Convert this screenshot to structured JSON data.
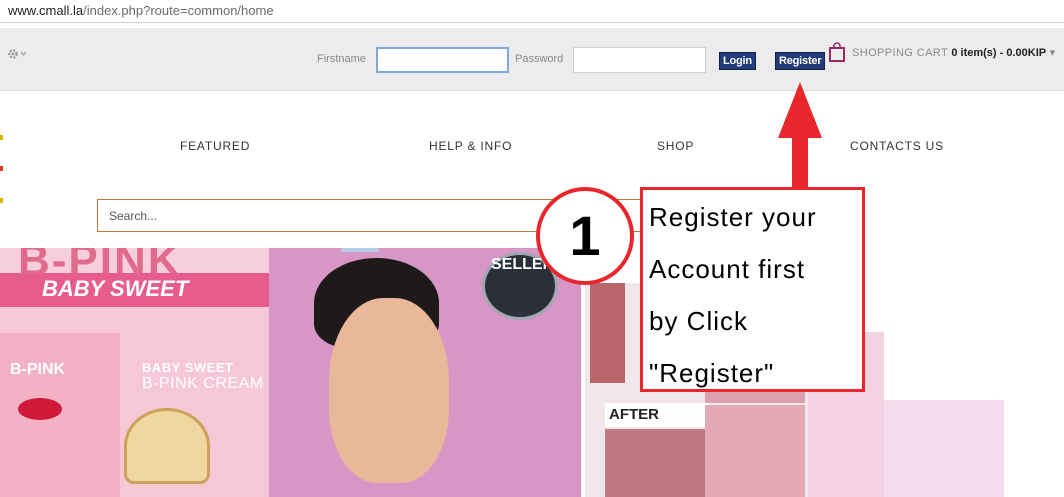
{
  "browser": {
    "url_host": "www.cmall.la",
    "url_path": "/index.php?route=common/home"
  },
  "topbar": {
    "settings_icon": "gear-icon",
    "firstname_label": "Firstname",
    "firstname_value": "",
    "password_label": "Password",
    "password_value": "",
    "login_label": "Login",
    "register_label": "Register",
    "cart_icon": "shopping-bag-icon",
    "cart_label": "SHOPPING CART",
    "cart_summary": "0 item(s) - 0.00KIP"
  },
  "nav": {
    "items": [
      "FEATURED",
      "HELP & INFO",
      "SHOP",
      "CONTACTS US"
    ]
  },
  "search": {
    "placeholder": "Search..."
  },
  "banner": {
    "brand_title": "B-PINK",
    "brand_subtitle": "BABY SWEET",
    "box_label": "B-PINK",
    "cream_line1": "BABY SWEET",
    "cream_line2": "B-PINK CREAM",
    "seller_badge": "SELLER",
    "after_label": "AFTER"
  },
  "annotation": {
    "step_number": "1",
    "lines": [
      "Register your",
      "Account first",
      "by Click",
      "\"Register\""
    ]
  },
  "colors": {
    "register_button": "#243b7a",
    "annotation_red": "#e8262b",
    "topbar_bg": "#ececec"
  }
}
